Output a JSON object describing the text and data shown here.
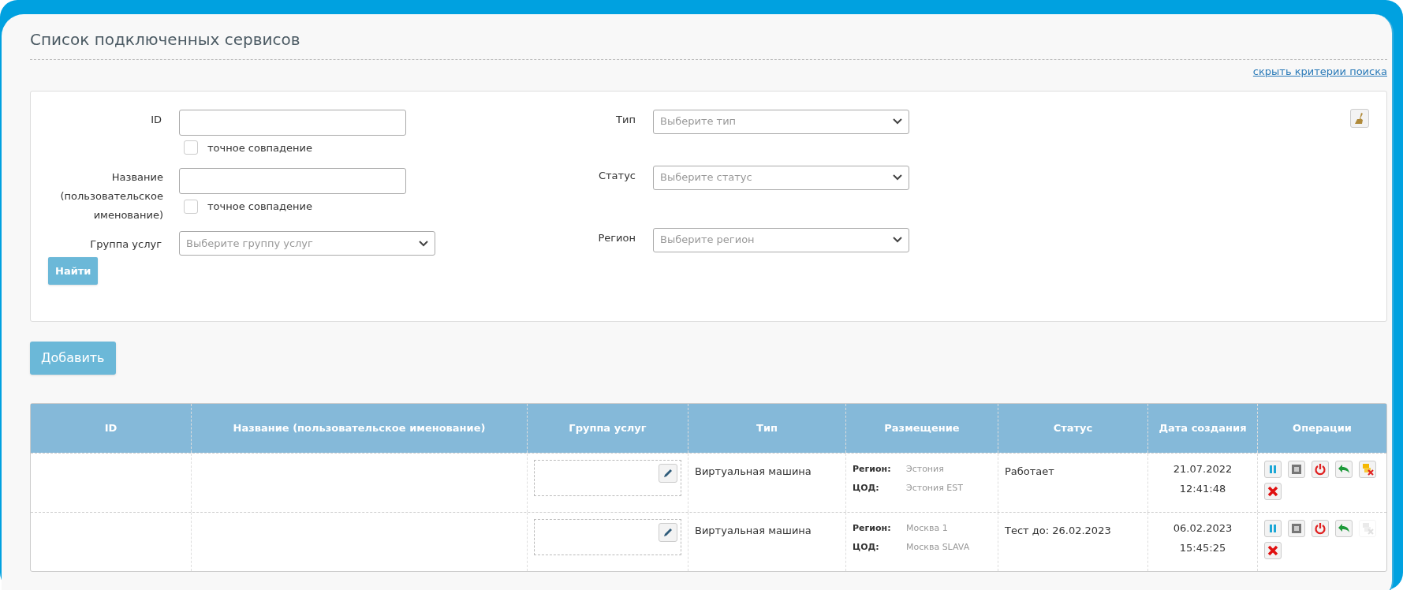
{
  "title": "Список подключенных сервисов",
  "toggle_link": "скрыть критерии поиска",
  "filters": {
    "id": {
      "label": "ID",
      "exact_label": "точное совпадение",
      "exact_checked": false
    },
    "name": {
      "label": "Название (пользовательское именование)",
      "exact_label": "точное совпадение",
      "exact_checked": false
    },
    "group": {
      "label": "Группа услуг",
      "placeholder": "Выберите группу услуг"
    },
    "type": {
      "label": "Тип",
      "placeholder": "Выберите тип"
    },
    "status": {
      "label": "Статус",
      "placeholder": "Выберите статус"
    },
    "region": {
      "label": "Регион",
      "placeholder": "Выберите регион"
    },
    "search_button": "Найти"
  },
  "add_button": "Добавить",
  "table": {
    "columns": [
      "ID",
      "Название (пользовательское именование)",
      "Группа услуг",
      "Тип",
      "Размещение",
      "Статус",
      "Дата создания",
      "Операции"
    ],
    "rows": [
      {
        "type": "Виртуальная машина",
        "region_label": "Регион:",
        "region": "Эстония",
        "dc_label": "ЦОД:",
        "dc": "Эстония EST",
        "status": "Работает",
        "date": "21.07.2022",
        "time": "12:41:48",
        "operations": [
          {
            "kind": "pause",
            "disabled": false
          },
          {
            "kind": "stop",
            "disabled": false
          },
          {
            "kind": "reboot",
            "disabled": false
          },
          {
            "kind": "revert",
            "disabled": false
          },
          {
            "kind": "remove",
            "disabled": false
          },
          {
            "kind": "delete",
            "disabled": false
          }
        ]
      },
      {
        "type": "Виртуальная машина",
        "region_label": "Регион:",
        "region": "Москва 1",
        "dc_label": "ЦОД:",
        "dc": "Москва SLAVA",
        "status": "Тест до: 26.02.2023",
        "date": "06.02.2023",
        "time": "15:45:25",
        "operations": [
          {
            "kind": "pause",
            "disabled": false
          },
          {
            "kind": "stop",
            "disabled": false
          },
          {
            "kind": "reboot",
            "disabled": false
          },
          {
            "kind": "revert",
            "disabled": false
          },
          {
            "kind": "remove",
            "disabled": true
          },
          {
            "kind": "delete",
            "disabled": false
          }
        ]
      }
    ]
  }
}
